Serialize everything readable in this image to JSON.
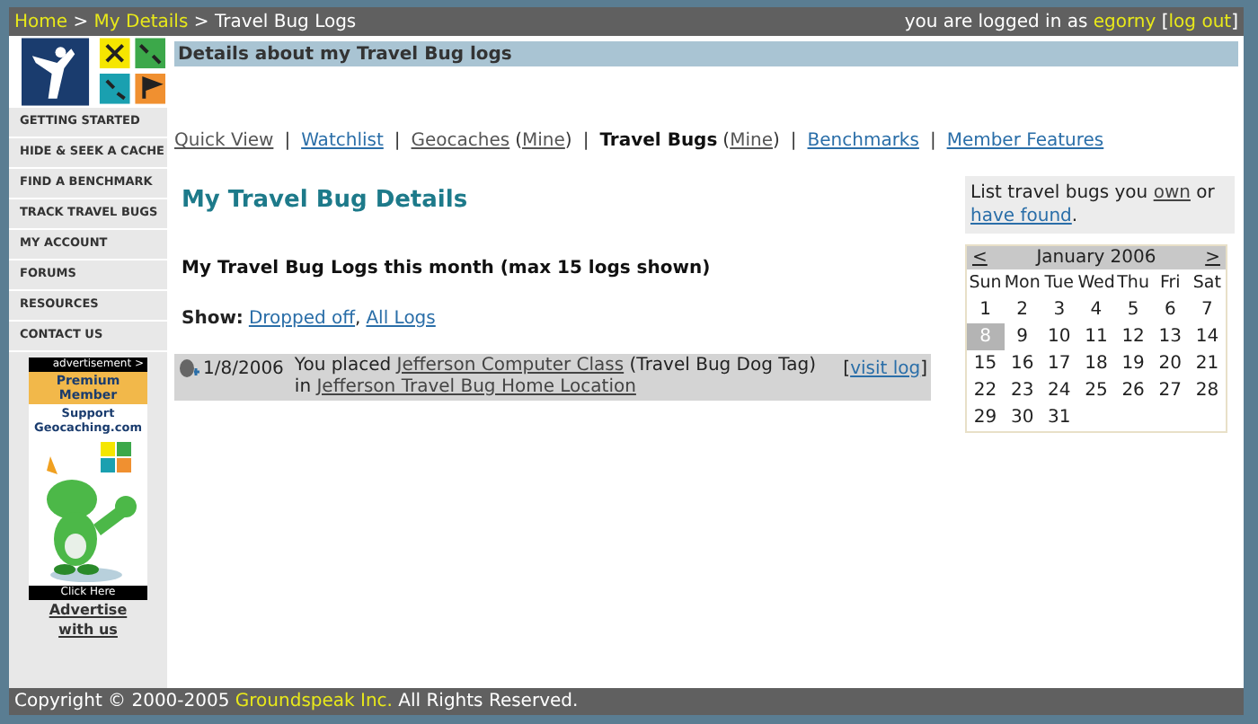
{
  "breadcrumb": {
    "items": [
      {
        "label": "Home",
        "link": true
      },
      {
        "label": "My Details",
        "link": true
      },
      {
        "label": "Travel Bug Logs",
        "link": false
      }
    ],
    "separator_parts": [
      " > ",
      " > "
    ]
  },
  "login": {
    "text": "you are logged in as ",
    "user": "egorny",
    "open": "[",
    "logout": "log out",
    "close": "]"
  },
  "sidebar": {
    "items": [
      "GETTING STARTED",
      "HIDE & SEEK A CACHE",
      "FIND A BENCHMARK",
      "TRACK TRAVEL BUGS",
      "MY ACCOUNT",
      "FORUMS",
      "RESOURCES",
      "CONTACT US"
    ],
    "ad": {
      "tag": "advertisement >",
      "title": "Premium Member",
      "support": "Support Geocaching.com",
      "cta": "Click Here",
      "link": "Advertise with us"
    }
  },
  "page_header": "Details about my Travel Bug logs",
  "nav": [
    {
      "label": "Quick View",
      "current": false,
      "visited": true
    },
    {
      "separator": "|",
      "label": "Watchlist",
      "current": false,
      "visited": false
    },
    {
      "separator": "|",
      "label": "Geocaches",
      "current": false,
      "visited": true,
      "mine": {
        "open": "(",
        "label": "Mine",
        "close": ")",
        "visited": true
      }
    },
    {
      "separator": "|",
      "label": "Travel Bugs",
      "current": true,
      "mine": {
        "open": "(",
        "label": "Mine",
        "close": ")",
        "visited": true
      }
    },
    {
      "separator": "|",
      "label": "Benchmarks",
      "current": false,
      "visited": false
    },
    {
      "separator": "|",
      "label": "Member Features",
      "current": false,
      "visited": false
    }
  ],
  "title": "My Travel Bug Details",
  "subtitle": "My Travel Bug Logs this month (max 15 logs shown)",
  "show": {
    "label": "Show:",
    "links": [
      {
        "label": "Dropped off",
        "sep": ","
      },
      {
        "label": "All Logs"
      }
    ]
  },
  "logs": [
    {
      "date": "1/8/2006",
      "before": "You placed ",
      "item": "Jefferson Computer Class",
      "middle": " (Travel Bug Dog Tag) in ",
      "place": "Jefferson Travel Bug Home Location",
      "visit": {
        "open": "[",
        "label": "visit log",
        "close": "]"
      }
    }
  ],
  "side_note": {
    "before": "List travel bugs you ",
    "own": "own",
    "middle": " or ",
    "found": "have found",
    "after": "."
  },
  "calendar": {
    "prev": "<",
    "title": "January 2006",
    "next": ">",
    "weekdays": [
      "Sun",
      "Mon",
      "Tue",
      "Wed",
      "Thu",
      "Fri",
      "Sat"
    ],
    "weeks": [
      [
        {
          "day": "1",
          "selected": false
        },
        {
          "day": "2",
          "selected": false
        },
        {
          "day": "3",
          "selected": false
        },
        {
          "day": "4",
          "selected": false
        },
        {
          "day": "5",
          "selected": false
        },
        {
          "day": "6",
          "selected": false
        },
        {
          "day": "7",
          "selected": false
        }
      ],
      [
        {
          "day": "8",
          "selected": true
        },
        {
          "day": "9",
          "selected": false
        },
        {
          "day": "10",
          "selected": false
        },
        {
          "day": "11",
          "selected": false
        },
        {
          "day": "12",
          "selected": false
        },
        {
          "day": "13",
          "selected": false
        },
        {
          "day": "14",
          "selected": false
        }
      ],
      [
        {
          "day": "15",
          "selected": false
        },
        {
          "day": "16",
          "selected": false
        },
        {
          "day": "17",
          "selected": false
        },
        {
          "day": "18",
          "selected": false
        },
        {
          "day": "19",
          "selected": false
        },
        {
          "day": "20",
          "selected": false
        },
        {
          "day": "21",
          "selected": false
        }
      ],
      [
        {
          "day": "22",
          "selected": false
        },
        {
          "day": "23",
          "selected": false
        },
        {
          "day": "24",
          "selected": false
        },
        {
          "day": "25",
          "selected": false
        },
        {
          "day": "26",
          "selected": false
        },
        {
          "day": "27",
          "selected": false
        },
        {
          "day": "28",
          "selected": false
        }
      ],
      [
        {
          "day": "29",
          "selected": false
        },
        {
          "day": "30",
          "selected": false
        },
        {
          "day": "31",
          "selected": false
        }
      ]
    ]
  },
  "footer": {
    "before": "Copyright © 2000-2005 ",
    "company": "Groundspeak Inc.",
    "after": " All Rights Reserved."
  }
}
